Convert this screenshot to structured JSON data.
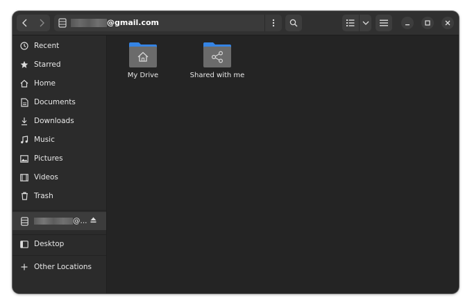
{
  "window": {
    "back_icon": "chevron-left-icon",
    "forward_icon": "chevron-right-icon"
  },
  "pathbar": {
    "account_suffix": "@gmail.com",
    "icon": "drive-icon"
  },
  "sidebar": {
    "items": [
      {
        "label": "Recent",
        "icon": "clock-icon"
      },
      {
        "label": "Starred",
        "icon": "star-icon"
      },
      {
        "label": "Home",
        "icon": "home-icon"
      },
      {
        "label": "Documents",
        "icon": "document-icon"
      },
      {
        "label": "Downloads",
        "icon": "download-icon"
      },
      {
        "label": "Music",
        "icon": "music-icon"
      },
      {
        "label": "Pictures",
        "icon": "picture-icon"
      },
      {
        "label": "Videos",
        "icon": "video-icon"
      },
      {
        "label": "Trash",
        "icon": "trash-icon"
      }
    ],
    "account_item": {
      "label": "@...",
      "icon": "drive-icon",
      "action_icon": "eject-icon"
    },
    "desktop": {
      "label": "Desktop",
      "icon": "desktop-icon"
    },
    "other_locations": {
      "label": "Other Locations",
      "icon": "plus-icon"
    }
  },
  "main": {
    "items": [
      {
        "label": "My Drive",
        "icon": "folder-home-icon"
      },
      {
        "label": "Shared with me",
        "icon": "folder-shared-icon"
      }
    ]
  },
  "colors": {
    "background": "#242424",
    "sidebar": "#2b2b2b",
    "headerbar": "#303030",
    "folder_blue": "#3584e4",
    "folder_body": "#6b6b6b"
  }
}
